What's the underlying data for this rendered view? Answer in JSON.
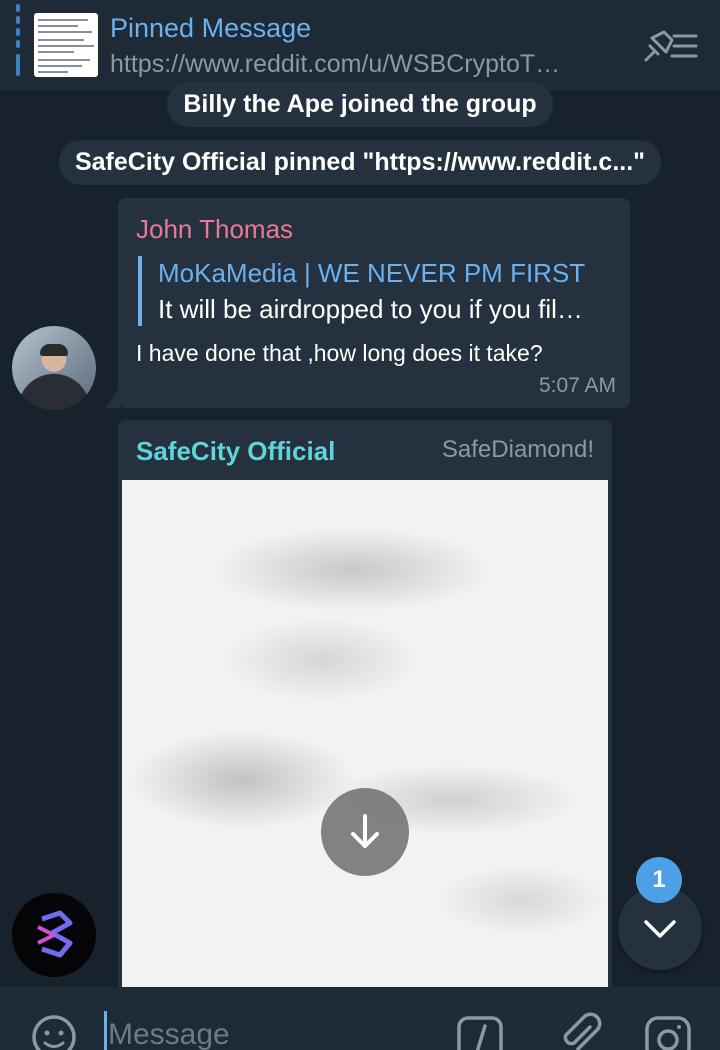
{
  "pinned": {
    "title": "Pinned Message",
    "preview": "https://www.reddit.com/u/WSBCryptoT…",
    "icon": "pinned-list-icon"
  },
  "service_messages": [
    "Billy the Ape joined the group",
    "SafeCity Official pinned \"https://www.reddit.c...\""
  ],
  "messages": [
    {
      "sender": "John Thomas",
      "sender_color": "#e87a96",
      "reply_to": {
        "name": "MoKaMedia | WE NEVER PM FIRST",
        "text": "It will be airdropped to you if you fil…"
      },
      "text": "I have done that ,how long does it take?",
      "time": "5:07 AM"
    },
    {
      "sender": "SafeCity Official",
      "sender_color": "#5fd4d9",
      "tag": "SafeDiamond!",
      "media": "blurred-image",
      "action_icon": "download-arrow-icon"
    }
  ],
  "scroll_down": {
    "unread_count": "1"
  },
  "composer": {
    "placeholder": "Message",
    "icons": [
      "emoji-icon",
      "bot-command-icon",
      "attach-icon",
      "camera-icon"
    ]
  },
  "colors": {
    "background": "#18222d",
    "bubble": "#25313e",
    "accent": "#6cb0ec",
    "badge": "#4d9fe6"
  }
}
